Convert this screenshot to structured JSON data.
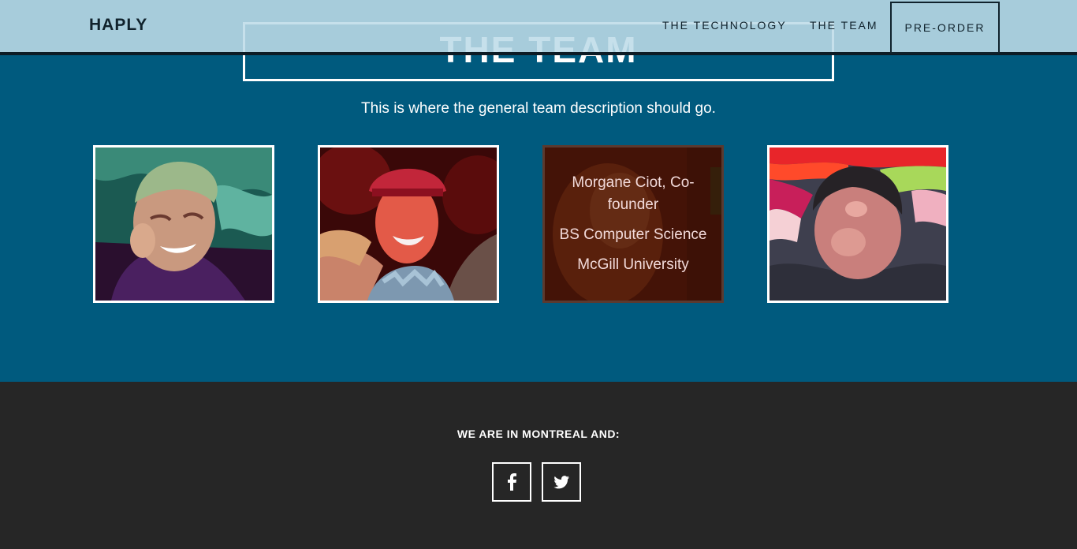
{
  "nav": {
    "brand": "HAPLY",
    "links": [
      "THE TECHNOLOGY",
      "THE TEAM"
    ],
    "cta": "PRE-ORDER"
  },
  "team": {
    "title": "THE TEAM",
    "description": "This is where the general team description should go.",
    "members": [
      {
        "photo": "team-member-photo-1"
      },
      {
        "photo": "team-member-photo-2"
      },
      {
        "photo": "team-member-photo-3",
        "name": "Morgane Ciot, Co-founder",
        "degree": "BS Computer Science",
        "school": "McGill University"
      },
      {
        "photo": "team-member-photo-4"
      }
    ]
  },
  "footer": {
    "heading": "WE ARE IN MONTREAL AND:",
    "social": [
      "facebook-icon",
      "twitter-icon"
    ]
  },
  "colors": {
    "nav_bg": "#bedce8",
    "team_bg": "#005a7e",
    "footer_bg": "#262626",
    "text_dark": "#10222c",
    "text_light": "#ffffff"
  }
}
